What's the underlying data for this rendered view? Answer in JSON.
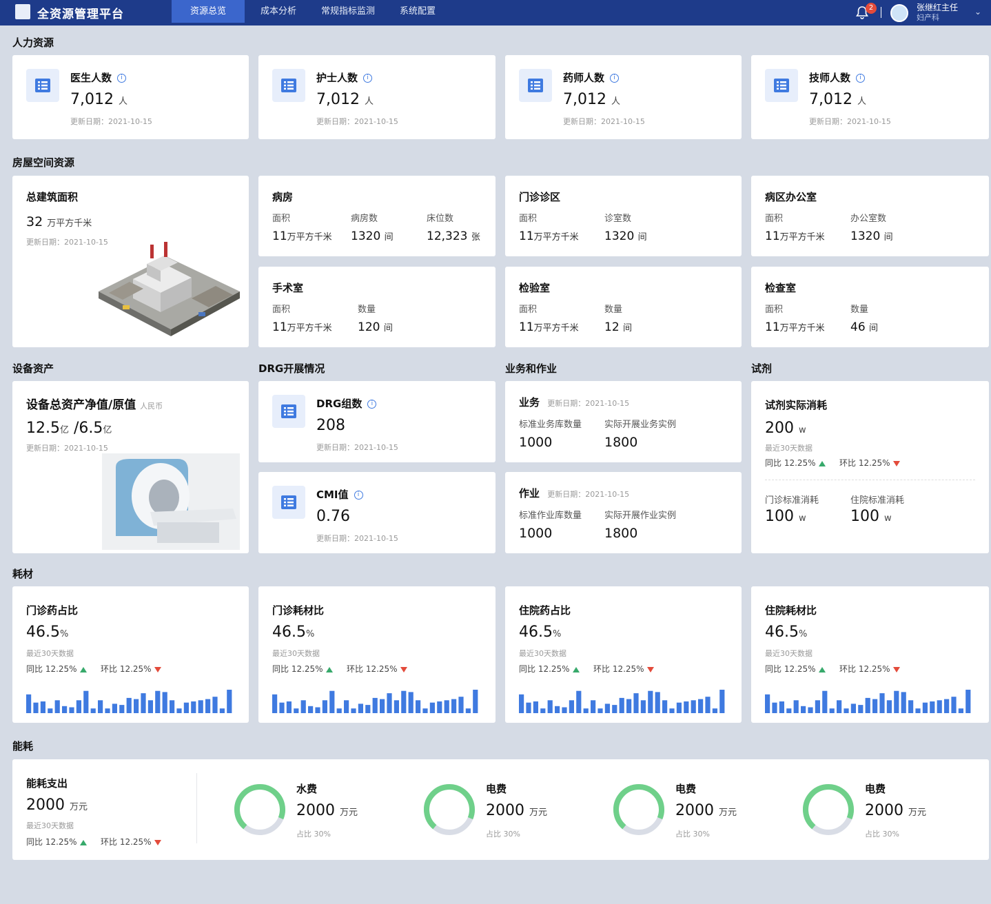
{
  "header": {
    "title": "全资源管理平台",
    "nav": [
      "资源总览",
      "成本分析",
      "常规指标监测",
      "系统配置"
    ],
    "notifications": "2",
    "user_name": "张继红主任",
    "user_dept": "妇产科"
  },
  "sections": {
    "hr": "人力资源",
    "space": "房屋空间资源",
    "equipment": "设备资产",
    "drg": "DRG开展情况",
    "business": "业务和作业",
    "reagent": "试剂",
    "consumable": "耗材",
    "energy": "能耗"
  },
  "update_text": "更新日期：2021-10-15",
  "hr_cards": [
    {
      "title": "医生人数",
      "value": "7,012",
      "unit": "人"
    },
    {
      "title": "护士人数",
      "value": "7,012",
      "unit": "人"
    },
    {
      "title": "药师人数",
      "value": "7,012",
      "unit": "人"
    },
    {
      "title": "技师人数",
      "value": "7,012",
      "unit": "人"
    }
  ],
  "space_total": {
    "title": "总建筑面积",
    "value": "32",
    "unit": "万平方千米"
  },
  "rooms": [
    {
      "title": "病房",
      "f": [
        {
          "l": "面积",
          "v": "11",
          "u": "万平方千米"
        },
        {
          "l": "病房数",
          "v": "1320",
          "u": "间"
        },
        {
          "l": "床位数",
          "v": "12,323",
          "u": "张"
        }
      ]
    },
    {
      "title": "门诊诊区",
      "f": [
        {
          "l": "面积",
          "v": "11",
          "u": "万平方千米"
        },
        {
          "l": "诊室数",
          "v": "1320",
          "u": "间"
        }
      ]
    },
    {
      "title": "病区办公室",
      "f": [
        {
          "l": "面积",
          "v": "11",
          "u": "万平方千米"
        },
        {
          "l": "办公室数",
          "v": "1320",
          "u": "间"
        }
      ]
    },
    {
      "title": "手术室",
      "f": [
        {
          "l": "面积",
          "v": "11",
          "u": "万平方千米"
        },
        {
          "l": "数量",
          "v": "120",
          "u": "间"
        }
      ]
    },
    {
      "title": "检验室",
      "f": [
        {
          "l": "面积",
          "v": "11",
          "u": "万平方千米"
        },
        {
          "l": "数量",
          "v": "12",
          "u": "间"
        }
      ]
    },
    {
      "title": "检查室",
      "f": [
        {
          "l": "面积",
          "v": "11",
          "u": "万平方千米"
        },
        {
          "l": "数量",
          "v": "46",
          "u": "间"
        }
      ]
    }
  ],
  "equipment": {
    "title": "设备总资产净值/原值",
    "unit_note": "人民币",
    "v1": "12.5",
    "u1": "亿",
    "sep": "/",
    "v2": "6.5",
    "u2": "亿"
  },
  "drg": [
    {
      "title": "DRG组数",
      "value": "208"
    },
    {
      "title": "CMI值",
      "value": "0.76"
    }
  ],
  "business": [
    {
      "title": "业务",
      "l1": "标准业务库数量",
      "l2": "实际开展业务实例",
      "v1": "1000",
      "v2": "1800"
    },
    {
      "title": "作业",
      "l1": "标准作业库数量",
      "l2": "实际开展作业实例",
      "v1": "1000",
      "v2": "1800"
    }
  ],
  "reagent": {
    "title": "试剂实际消耗",
    "value": "200",
    "unit": "w",
    "note": "最近30天数据",
    "l1": "门诊标准消耗",
    "v1": "100",
    "l2": "住院标准消耗",
    "v2": "100",
    "u": "w"
  },
  "compare": {
    "yoy": "同比 12.25%",
    "mom": "环比 12.25%"
  },
  "last30": "最近30天数据",
  "consumables": [
    {
      "title": "门诊药占比",
      "value": "46.5",
      "unit": "%"
    },
    {
      "title": "门诊耗材比",
      "value": "46.5",
      "unit": "%"
    },
    {
      "title": "住院药占比",
      "value": "46.5",
      "unit": "%"
    },
    {
      "title": "住院耗材比",
      "value": "46.5",
      "unit": "%"
    }
  ],
  "bars": [
    0.8,
    0.45,
    0.5,
    0.2,
    0.55,
    0.3,
    0.25,
    0.55,
    0.95,
    0.2,
    0.55,
    0.2,
    0.4,
    0.35,
    0.65,
    0.6,
    0.85,
    0.55,
    0.95,
    0.9,
    0.55,
    0.2,
    0.45,
    0.5,
    0.55,
    0.6,
    0.7,
    0.2,
    1.0
  ],
  "energy": {
    "title": "能耗支出",
    "value": "2000",
    "unit": "万元",
    "items": [
      {
        "title": "水费",
        "value": "2000",
        "unit": "万元",
        "share": "占比 30%",
        "pct": 0.3
      },
      {
        "title": "电费",
        "value": "2000",
        "unit": "万元",
        "share": "占比 30%",
        "pct": 0.3
      },
      {
        "title": "电费",
        "value": "2000",
        "unit": "万元",
        "share": "占比 30%",
        "pct": 0.3
      },
      {
        "title": "电费",
        "value": "2000",
        "unit": "万元",
        "share": "占比 30%",
        "pct": 0.3
      }
    ]
  },
  "colors": {
    "header": "#1e3b8a",
    "nav_active": "#3b66cc",
    "bar": "#3f7ae0",
    "donut": "#6fd08a",
    "donut_track": "#d9dde6",
    "up": "#37a96b",
    "down": "#e34b3b"
  }
}
